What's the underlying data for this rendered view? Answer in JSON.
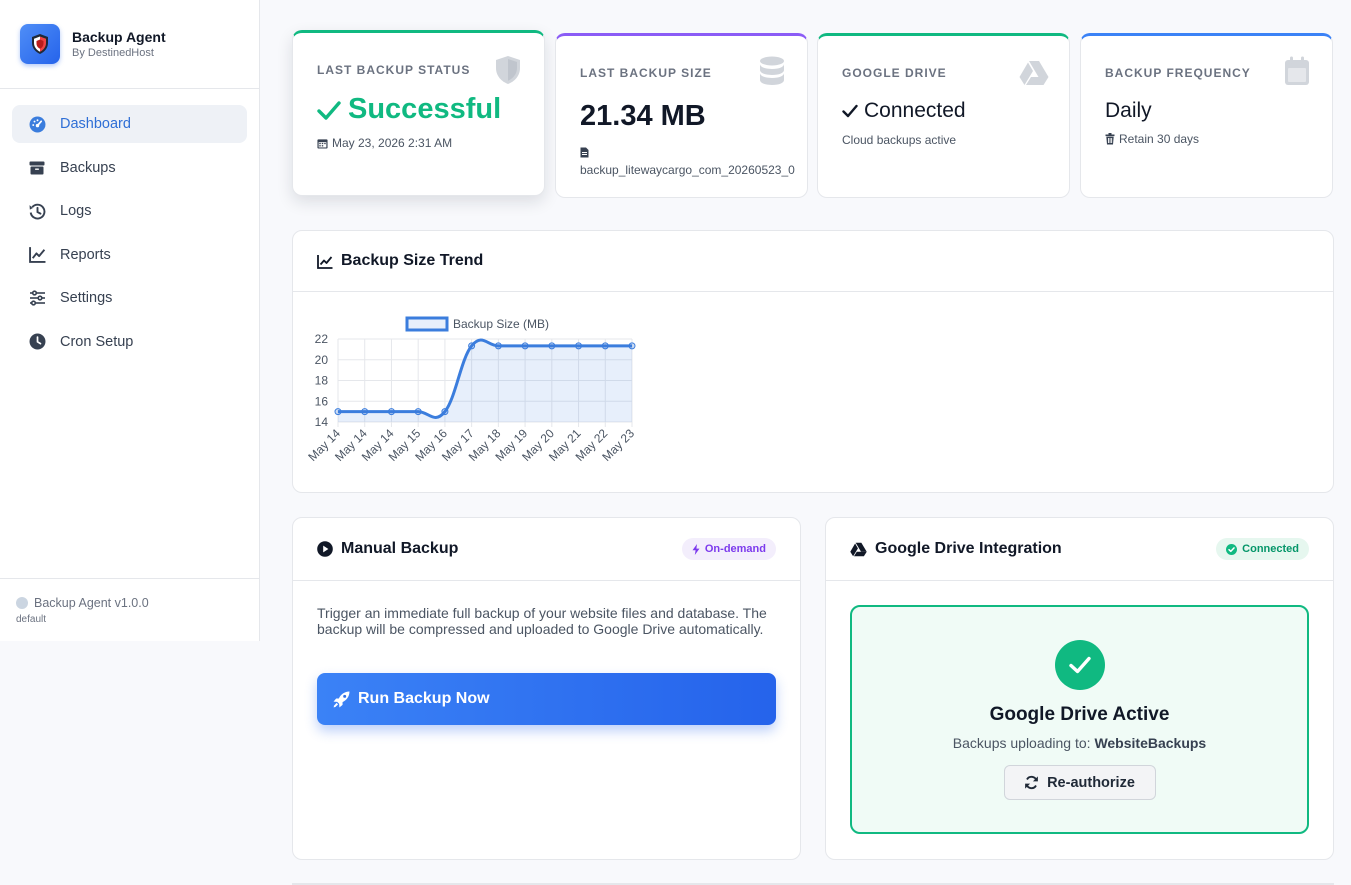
{
  "brand": {
    "title": "Backup Agent",
    "subtitle": "By DestinedHost"
  },
  "nav": [
    {
      "label": "Dashboard",
      "icon": "gauge-icon",
      "active": true
    },
    {
      "label": "Backups",
      "icon": "archive-icon"
    },
    {
      "label": "Logs",
      "icon": "history-icon"
    },
    {
      "label": "Reports",
      "icon": "chart-line-icon"
    },
    {
      "label": "Settings",
      "icon": "sliders-icon"
    },
    {
      "label": "Cron Setup",
      "icon": "clock-icon"
    }
  ],
  "footer": {
    "version": "Backup Agent v1.0.0",
    "profile": "default"
  },
  "stats": {
    "status": {
      "label": "Last Backup Status",
      "value": "Successful",
      "sub": "May 23, 2026 2:31 AM",
      "color": "#10b981"
    },
    "size": {
      "label": "Last Backup Size",
      "value": "21.34 MB",
      "sub": "backup_litewaycargo_com_20260523_0",
      "color": "#8b5cf6"
    },
    "drive": {
      "label": "Google Drive",
      "value": "Connected",
      "sub": "Cloud backups active",
      "color": "#10b981"
    },
    "frequency": {
      "label": "Backup Frequency",
      "value": "Daily",
      "sub": "Retain 30 days",
      "color": "#3b82f6"
    }
  },
  "trend": {
    "title": "Backup Size Trend"
  },
  "chart_data": {
    "type": "line",
    "categories": [
      "May 14",
      "May 14",
      "May 14",
      "May 15",
      "May 16",
      "May 17",
      "May 18",
      "May 19",
      "May 20",
      "May 21",
      "May 22",
      "May 23"
    ],
    "series": [
      {
        "name": "Backup Size (MB)",
        "values": [
          15,
          15,
          15,
          15,
          15,
          21.34,
          21.34,
          21.34,
          21.34,
          21.34,
          21.34,
          21.34
        ],
        "color": "#3b7ddd"
      }
    ],
    "yticks": [
      14,
      16,
      18,
      20,
      22
    ],
    "ylim": [
      14,
      22
    ],
    "grid": true,
    "legend": "top",
    "fill": true
  },
  "manual": {
    "title": "Manual Backup",
    "badge": "On-demand",
    "description": "Trigger an immediate full backup of your website files and database. The backup will be compressed and uploaded to Google Drive automatically.",
    "button": "Run Backup Now"
  },
  "gdrive": {
    "title": "Google Drive Integration",
    "badge": "Connected",
    "active_title": "Google Drive Active",
    "uploading_prefix": "Backups uploading to:",
    "folder": "WebsiteBackups",
    "reauth": "Re-authorize"
  }
}
